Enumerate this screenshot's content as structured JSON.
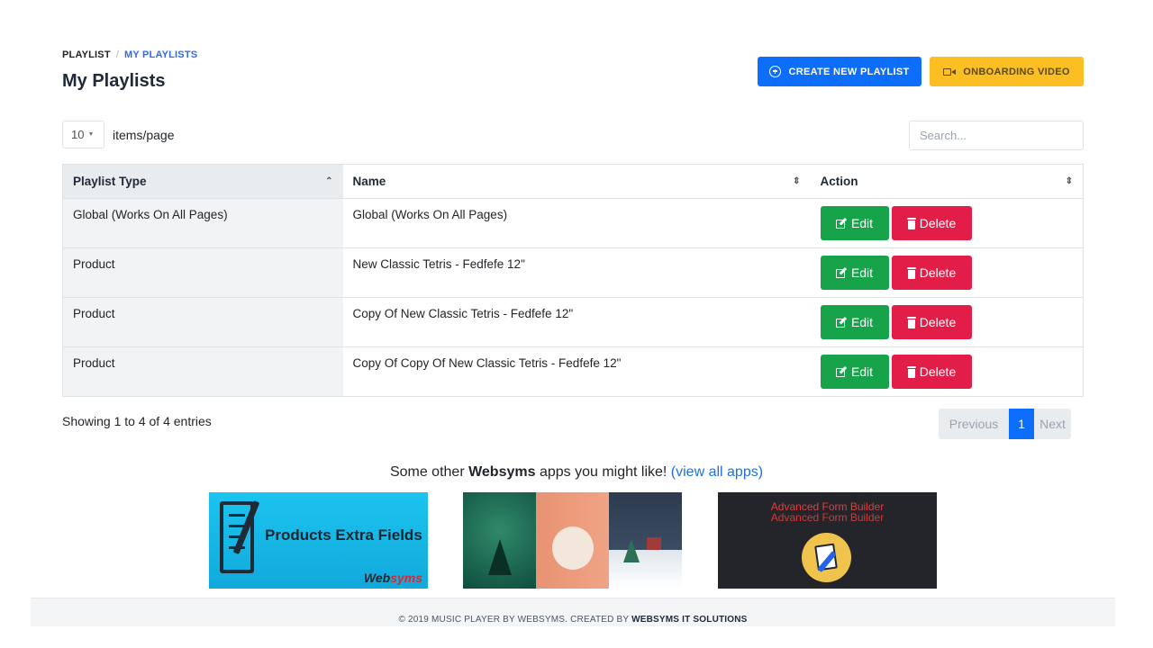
{
  "breadcrumb": {
    "root": "PLAYLIST",
    "separator": "/",
    "current": "MY PLAYLISTS"
  },
  "page_title": "My Playlists",
  "buttons": {
    "create": "CREATE NEW PLAYLIST",
    "onboarding": "ONBOARDING VIDEO"
  },
  "page_size": {
    "value": "10",
    "label": "items/page"
  },
  "search": {
    "placeholder": "Search...",
    "value": ""
  },
  "table": {
    "columns": [
      "Playlist Type",
      "Name",
      "Action"
    ],
    "edit_label": "Edit",
    "delete_label": "Delete",
    "rows": [
      {
        "type": "Global (Works On All Pages)",
        "name": "Global (Works On All Pages)"
      },
      {
        "type": "Product",
        "name": "New Classic Tetris - Fedfefe 12\""
      },
      {
        "type": "Product",
        "name": "Copy Of New Classic Tetris - Fedfefe 12\""
      },
      {
        "type": "Product",
        "name": "Copy Of Copy Of New Classic Tetris - Fedfefe 12\""
      }
    ]
  },
  "entries_text": "Showing 1 to 4 of 4 entries",
  "pagination": {
    "previous": "Previous",
    "current": "1",
    "next": "Next"
  },
  "promo": {
    "prefix": "Some other ",
    "brand": "Websyms",
    "suffix": " apps you might like! ",
    "link": "(view all apps)",
    "apps": [
      {
        "title": "Products Extra Fields",
        "brand_a": "Web",
        "brand_b": "syms"
      },
      {
        "title": ""
      },
      {
        "title_line1": "Advanced Form Builder",
        "title_line2": "Advanced Form Builder"
      }
    ]
  },
  "footer": {
    "prefix": "© 2019 MUSIC PLAYER BY WEBSYMS. CREATED BY ",
    "company": "WEBSYMS IT SOLUTIONS"
  },
  "colors": {
    "primary": "#0d6efd",
    "warning": "#fbbf24",
    "success": "#16a34a",
    "danger": "#e11d48"
  }
}
